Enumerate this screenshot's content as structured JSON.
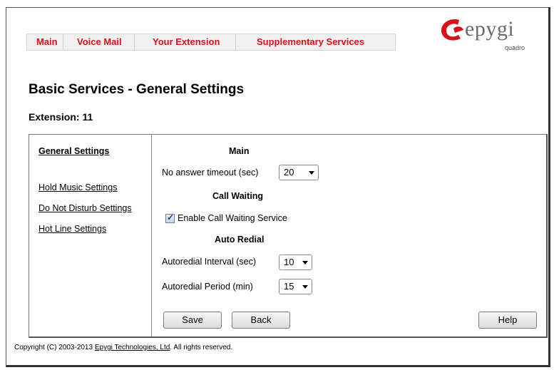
{
  "nav": {
    "items": [
      {
        "label": "Main"
      },
      {
        "label": "Voice Mail"
      },
      {
        "label": "Your Extension"
      },
      {
        "label": "Supplementary Services"
      }
    ]
  },
  "logo": {
    "word": "epygi",
    "sub": "quadro",
    "brand_color": "#d8121b"
  },
  "page": {
    "title": "Basic Services - General Settings",
    "extension": "Extension: 11"
  },
  "sidebar": {
    "items": [
      {
        "label": "General Settings"
      },
      {
        "label": "Hold Music Settings"
      },
      {
        "label": "Do Not Disturb Settings"
      },
      {
        "label": "Hot Line Settings"
      }
    ]
  },
  "main": {
    "section_main": "Main",
    "no_answer_label": "No answer timeout (sec)",
    "no_answer_value": "20",
    "section_call_waiting": "Call Waiting",
    "call_waiting_label": "Enable Call Waiting Service",
    "call_waiting_checked": true,
    "section_auto_redial": "Auto Redial",
    "redial_interval_label": "Autoredial Interval (sec)",
    "redial_interval_value": "10",
    "redial_period_label": "Autoredial Period (min)",
    "redial_period_value": "15"
  },
  "buttons": {
    "save": "Save",
    "back": "Back",
    "help": "Help"
  },
  "footer": {
    "prefix": "Copyright (C) 2003-2013 ",
    "link": "Epygi Technologies, Ltd",
    "suffix": ". All rights reserved."
  }
}
